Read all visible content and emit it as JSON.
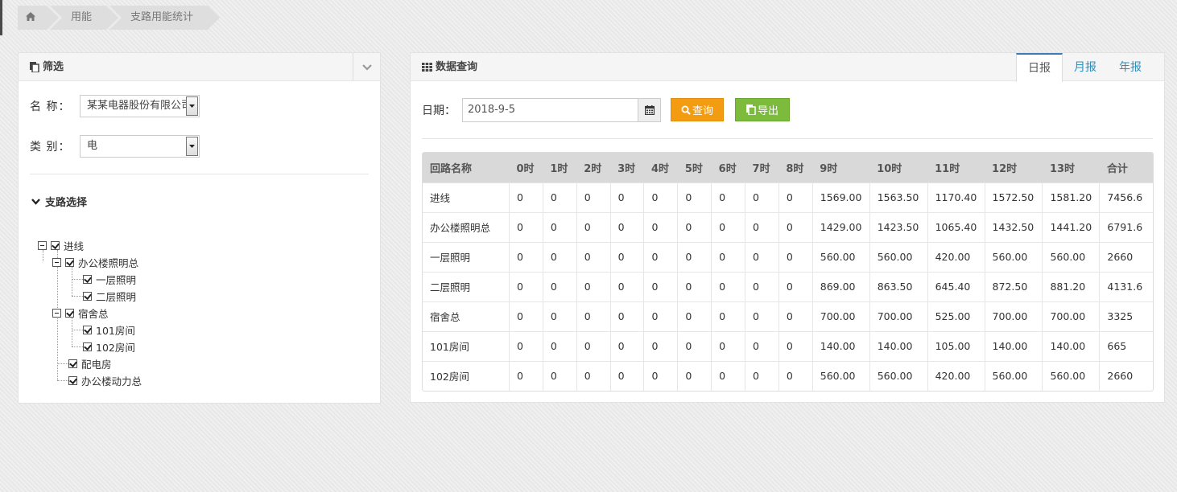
{
  "breadcrumb": {
    "items": [
      "用能",
      "支路用能统计"
    ]
  },
  "filter_panel": {
    "title": "筛选",
    "name_label": "名 称：",
    "name_value": "某某电器股份有限公司",
    "category_label": "类 别：",
    "category_value": "电",
    "tree_title": "支路选择",
    "tree": {
      "root": "进线",
      "office_lighting": "办公楼照明总",
      "floor1_lighting": "一层照明",
      "floor2_lighting": "二层照明",
      "dorm": "宿舍总",
      "room101": "101房间",
      "room102": "102房间",
      "power_room": "配电房",
      "office_power": "办公楼动力总"
    }
  },
  "query_panel": {
    "title": "数据查询",
    "tabs": [
      "日报",
      "月报",
      "年报"
    ],
    "active_tab": "日报",
    "date_label": "日期：",
    "date_value": "2018-9-5",
    "query_button": "查询",
    "export_button": "导出"
  },
  "table": {
    "columns": [
      "回路名称",
      "0时",
      "1时",
      "2时",
      "3时",
      "4时",
      "5时",
      "6时",
      "7时",
      "8时",
      "9时",
      "10时",
      "11时",
      "12时",
      "13时",
      "合计"
    ],
    "rows": [
      [
        "进线",
        "0",
        "0",
        "0",
        "0",
        "0",
        "0",
        "0",
        "0",
        "0",
        "1569.00",
        "1563.50",
        "1170.40",
        "1572.50",
        "1581.20",
        "7456.6"
      ],
      [
        "办公楼照明总",
        "0",
        "0",
        "0",
        "0",
        "0",
        "0",
        "0",
        "0",
        "0",
        "1429.00",
        "1423.50",
        "1065.40",
        "1432.50",
        "1441.20",
        "6791.6"
      ],
      [
        "一层照明",
        "0",
        "0",
        "0",
        "0",
        "0",
        "0",
        "0",
        "0",
        "0",
        "560.00",
        "560.00",
        "420.00",
        "560.00",
        "560.00",
        "2660"
      ],
      [
        "二层照明",
        "0",
        "0",
        "0",
        "0",
        "0",
        "0",
        "0",
        "0",
        "0",
        "869.00",
        "863.50",
        "645.40",
        "872.50",
        "881.20",
        "4131.6"
      ],
      [
        "宿舍总",
        "0",
        "0",
        "0",
        "0",
        "0",
        "0",
        "0",
        "0",
        "0",
        "700.00",
        "700.00",
        "525.00",
        "700.00",
        "700.00",
        "3325"
      ],
      [
        "101房间",
        "0",
        "0",
        "0",
        "0",
        "0",
        "0",
        "0",
        "0",
        "0",
        "140.00",
        "140.00",
        "105.00",
        "140.00",
        "140.00",
        "665"
      ],
      [
        "102房间",
        "0",
        "0",
        "0",
        "0",
        "0",
        "0",
        "0",
        "0",
        "0",
        "560.00",
        "560.00",
        "420.00",
        "560.00",
        "560.00",
        "2660"
      ]
    ]
  },
  "colors": {
    "query_button": "#f39c12",
    "export_button": "#7cbb3c",
    "active_tab_border": "#3d7bb0",
    "tab_link": "#2a8fbd"
  },
  "icons": {
    "home": "home-icon",
    "filter": "copy-icon",
    "collapse": "chevron-down-icon",
    "tree_toggle": "chevron-down-icon",
    "grid": "grid-icon",
    "calendar": "calendar-icon",
    "search": "search-icon",
    "export": "copy-icon"
  }
}
